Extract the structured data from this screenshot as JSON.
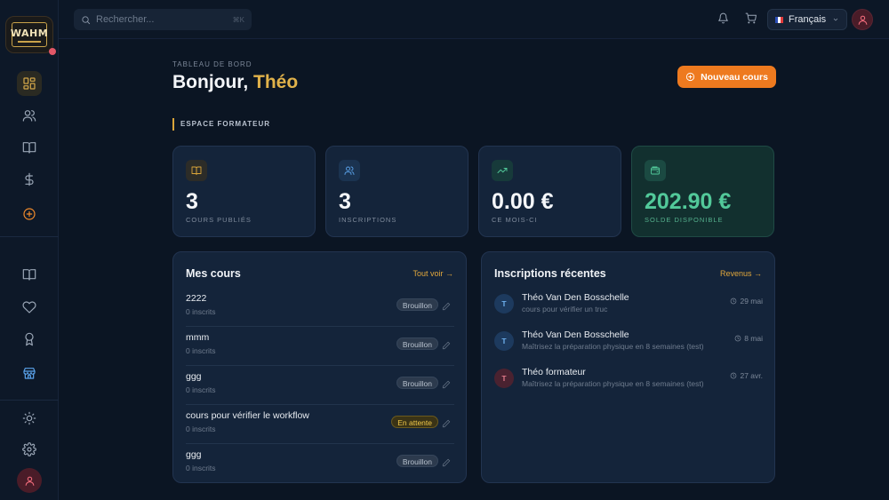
{
  "logo": {
    "text": "WAHM"
  },
  "search": {
    "placeholder": "Rechercher...",
    "shortcut": "⌘K"
  },
  "language": {
    "selected": "Français"
  },
  "header": {
    "breadcrumb": "TABLEAU DE BORD",
    "greeting": "Bonjour,",
    "user_name": "Théo",
    "new_course_label": "Nouveau cours"
  },
  "section": {
    "label": "ESPACE FORMATEUR"
  },
  "stats": [
    {
      "value": "3",
      "label": "COURS PUBLIÉS",
      "icon": "book-icon",
      "color": "#d9a43a"
    },
    {
      "value": "3",
      "label": "INSCRIPTIONS",
      "icon": "users-icon",
      "color": "#5aa2ea"
    },
    {
      "value": "0.00 €",
      "label": "CE MOIS-CI",
      "icon": "trending-up-icon",
      "color": "#52c99a"
    },
    {
      "value": "202.90 €",
      "label": "SOLDE DISPONIBLE",
      "icon": "wallet-icon",
      "color": "#52c99a"
    }
  ],
  "courses": {
    "title": "Mes cours",
    "link": "Tout voir →",
    "items": [
      {
        "title": "2222",
        "subscribers": "0 inscrits",
        "status": "Brouillon"
      },
      {
        "title": "mmm",
        "subscribers": "0 inscrits",
        "status": "Brouillon"
      },
      {
        "title": "ggg",
        "subscribers": "0 inscrits",
        "status": "Brouillon"
      },
      {
        "title": "cours pour vérifier le workflow",
        "subscribers": "0 inscrits",
        "status": "En attente"
      },
      {
        "title": "ggg",
        "subscribers": "0 inscrits",
        "status": "Brouillon"
      }
    ]
  },
  "enrollments": {
    "title": "Inscriptions récentes",
    "link": "Revenus →",
    "items": [
      {
        "initial": "T",
        "name": "Théo Van Den Bosschelle",
        "course": "cours pour vérifier un truc",
        "date": "29 mai"
      },
      {
        "initial": "T",
        "name": "Théo Van Den Bosschelle",
        "course": "Maîtrisez la préparation physique en 8 semaines (test)",
        "date": "8 mai"
      },
      {
        "initial": "T",
        "name": "Théo formateur",
        "course": "Maîtrisez la préparation physique en 8 semaines (test)",
        "date": "27 avr."
      }
    ]
  },
  "colors": {
    "accent": "#ee7a1f",
    "gold": "#e1b24a",
    "background": "#0b1523"
  }
}
